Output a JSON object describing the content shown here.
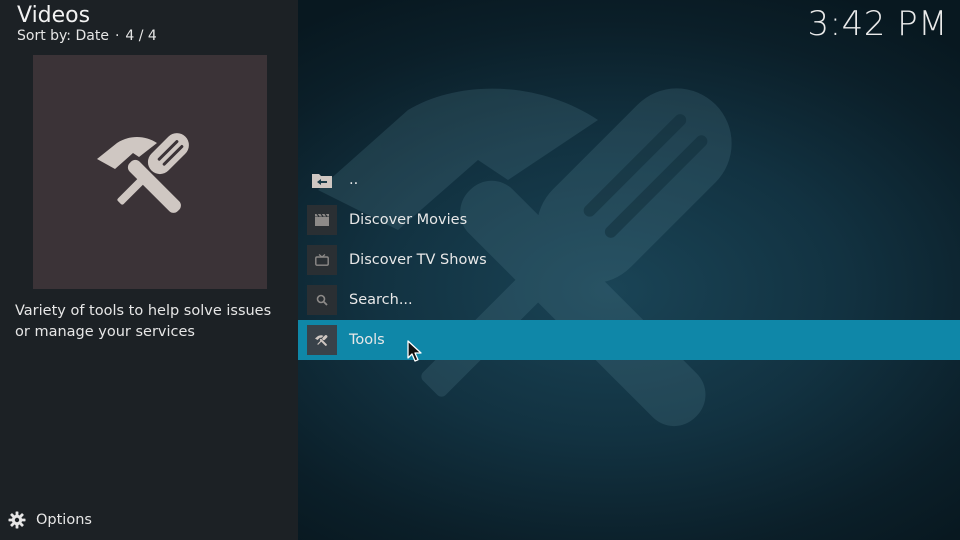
{
  "header": {
    "title": "Videos",
    "sort_label": "Sort by: Date",
    "separator": "·",
    "count": "4 / 4"
  },
  "clock": "3:42 PM",
  "preview": {
    "icon": "tools-icon",
    "description": "Variety of tools to help solve issues or manage your services"
  },
  "list": {
    "items": [
      {
        "label": "..",
        "icon": "folder-back-icon"
      },
      {
        "label": "Discover Movies",
        "icon": "film-icon"
      },
      {
        "label": "Discover TV Shows",
        "icon": "tv-icon"
      },
      {
        "label": "Search...",
        "icon": "search-icon"
      },
      {
        "label": "Tools",
        "icon": "tools-icon",
        "selected": true
      }
    ]
  },
  "footer": {
    "options_label": "Options",
    "options_icon": "gear-icon"
  },
  "colors": {
    "accent": "#0f87a8",
    "panel": "#1c2125",
    "thumb_bg": "#3b3337",
    "icon_fg": "#cfc7c2"
  }
}
